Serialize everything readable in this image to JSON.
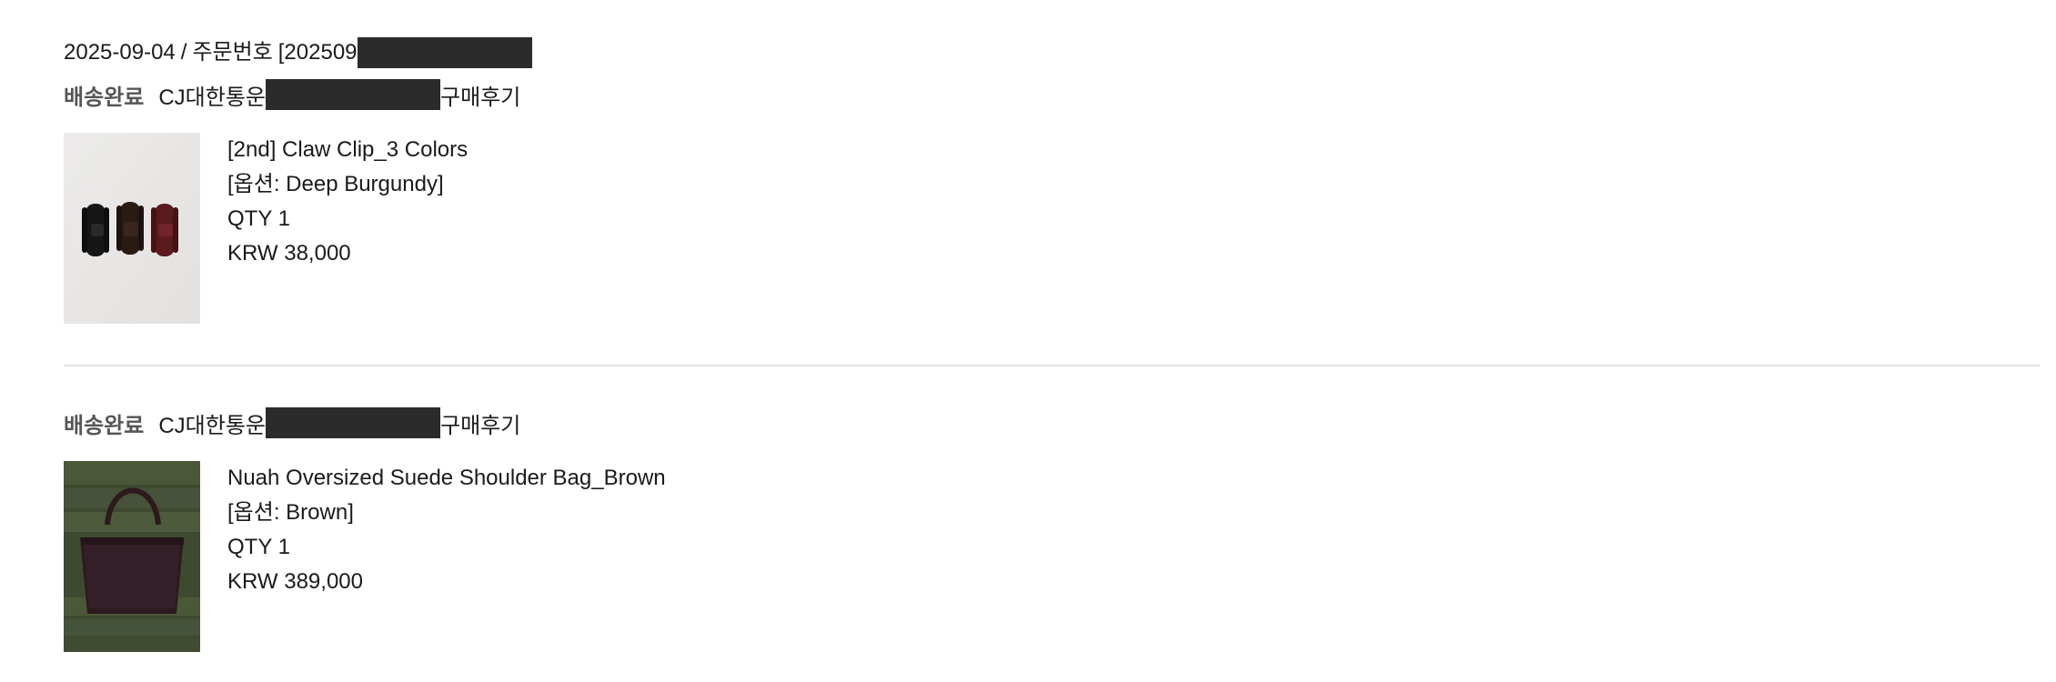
{
  "order": {
    "date": "2025-09-04",
    "separator": "/",
    "order_number_label": "주문번호",
    "order_number_prefix": "[202509"
  },
  "shipments": [
    {
      "status": "배송완료",
      "carrier": "CJ대한통운",
      "review_label": "구매후기",
      "item": {
        "image_icon": "claw-clip-product-image",
        "name": "[2nd] Claw Clip_3 Colors",
        "option": "[옵션: Deep Burgundy]",
        "qty": "QTY 1",
        "price": "KRW 38,000"
      }
    },
    {
      "status": "배송완료",
      "carrier": "CJ대한통운",
      "review_label": "구매후기",
      "item": {
        "image_icon": "shoulder-bag-product-image",
        "name": "Nuah Oversized Suede Shoulder Bag_Brown",
        "option": "[옵션: Brown]",
        "qty": "QTY 1",
        "price": "KRW 389,000"
      }
    }
  ],
  "colors": {
    "redaction": "#2b2b2b",
    "divider": "#e2e2e2",
    "status_text": "#555555"
  }
}
